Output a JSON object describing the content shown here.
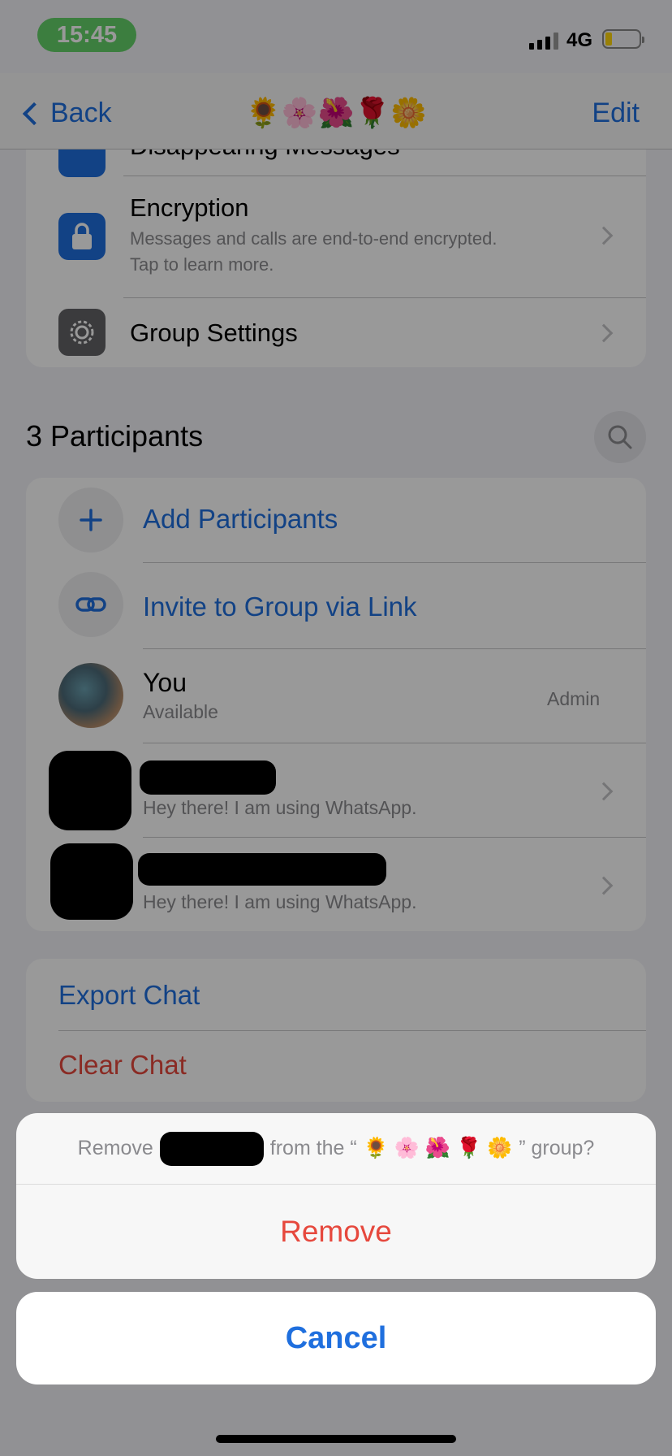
{
  "status_bar": {
    "time": "15:45",
    "network": "4G"
  },
  "nav": {
    "back_label": "Back",
    "title": "🌻🌸🌺🌹🌼",
    "edit_label": "Edit"
  },
  "settings": {
    "disappearing_label": "Disappearing Messages",
    "encryption_title": "Encryption",
    "encryption_sub1": "Messages and calls are end-to-end encrypted.",
    "encryption_sub2": "Tap to learn more.",
    "group_settings_label": "Group Settings"
  },
  "participants": {
    "heading": "3 Participants",
    "add_label": "Add Participants",
    "invite_label": "Invite to Group via Link",
    "members": [
      {
        "name": "You",
        "status": "Available",
        "role": "Admin"
      },
      {
        "name": "",
        "status": "Hey there! I am using WhatsApp."
      },
      {
        "name": "",
        "status": "Hey there! I am using WhatsApp."
      }
    ]
  },
  "chat_actions": {
    "export_label": "Export Chat",
    "clear_label": "Clear Chat"
  },
  "sheet": {
    "prefix": "Remove",
    "middle": "from the “",
    "group_name": "🌻 🌸 🌺 🌹 🌼",
    "suffix": "” group?",
    "remove_label": "Remove",
    "cancel_label": "Cancel"
  },
  "colors": {
    "accent": "#1f6fde",
    "destructive": "#e6483d",
    "status_time_bg": "#64d269"
  }
}
